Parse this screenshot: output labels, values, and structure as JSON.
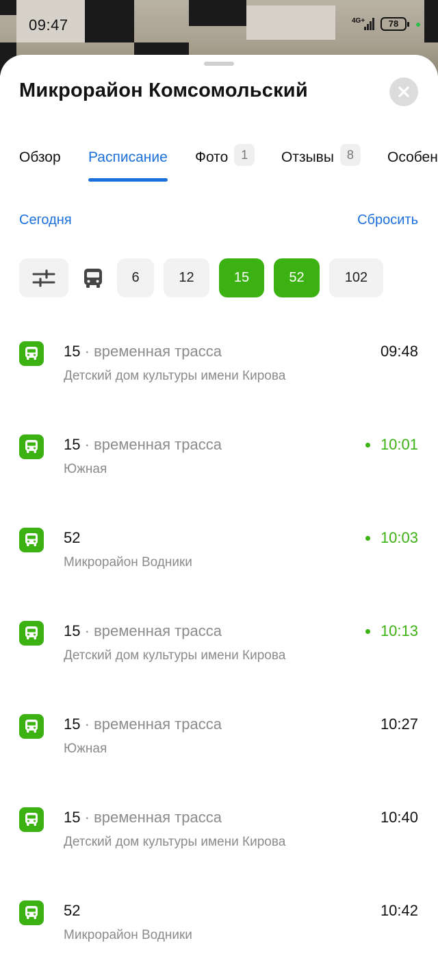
{
  "status_bar": {
    "time": "09:47",
    "network": "4G+",
    "battery": "78",
    "indicator_color": "#2bbd4a"
  },
  "sheet": {
    "title": "Микрорайон Комсомольский",
    "close_icon": "close-icon"
  },
  "tabs": [
    {
      "label": "Обзор",
      "badge": null,
      "active": false
    },
    {
      "label": "Расписание",
      "badge": null,
      "active": true
    },
    {
      "label": "Фото",
      "badge": "1",
      "active": false
    },
    {
      "label": "Отзывы",
      "badge": "8",
      "active": false
    },
    {
      "label": "Особен",
      "badge": null,
      "active": false
    }
  ],
  "links": {
    "today": "Сегодня",
    "reset": "Сбросить"
  },
  "filters": {
    "settings_icon": "sliders-icon",
    "transport_icon": "bus-icon",
    "routes": [
      {
        "label": "6",
        "selected": false
      },
      {
        "label": "12",
        "selected": false
      },
      {
        "label": "15",
        "selected": true
      },
      {
        "label": "52",
        "selected": true
      },
      {
        "label": "102",
        "selected": false
      }
    ]
  },
  "colors": {
    "accent_blue": "#1a6fdc",
    "accent_green": "#3bb212",
    "muted_text": "#8b8b8b"
  },
  "schedule": [
    {
      "route": "15",
      "separator": "·",
      "note": "временная трасса",
      "destination": "Детский дом культуры имени Кирова",
      "time": "09:48",
      "live": false
    },
    {
      "route": "15",
      "separator": "·",
      "note": "временная трасса",
      "destination": "Южная",
      "time": "10:01",
      "live": true
    },
    {
      "route": "52",
      "separator": "",
      "note": "",
      "destination": "Микрорайон Водники",
      "time": "10:03",
      "live": true
    },
    {
      "route": "15",
      "separator": "·",
      "note": "временная трасса",
      "destination": "Детский дом культуры имени Кирова",
      "time": "10:13",
      "live": true
    },
    {
      "route": "15",
      "separator": "·",
      "note": "временная трасса",
      "destination": "Южная",
      "time": "10:27",
      "live": false
    },
    {
      "route": "15",
      "separator": "·",
      "note": "временная трасса",
      "destination": "Детский дом культуры имени Кирова",
      "time": "10:40",
      "live": false
    },
    {
      "route": "52",
      "separator": "",
      "note": "",
      "destination": "Микрорайон Водники",
      "time": "10:42",
      "live": false
    }
  ]
}
